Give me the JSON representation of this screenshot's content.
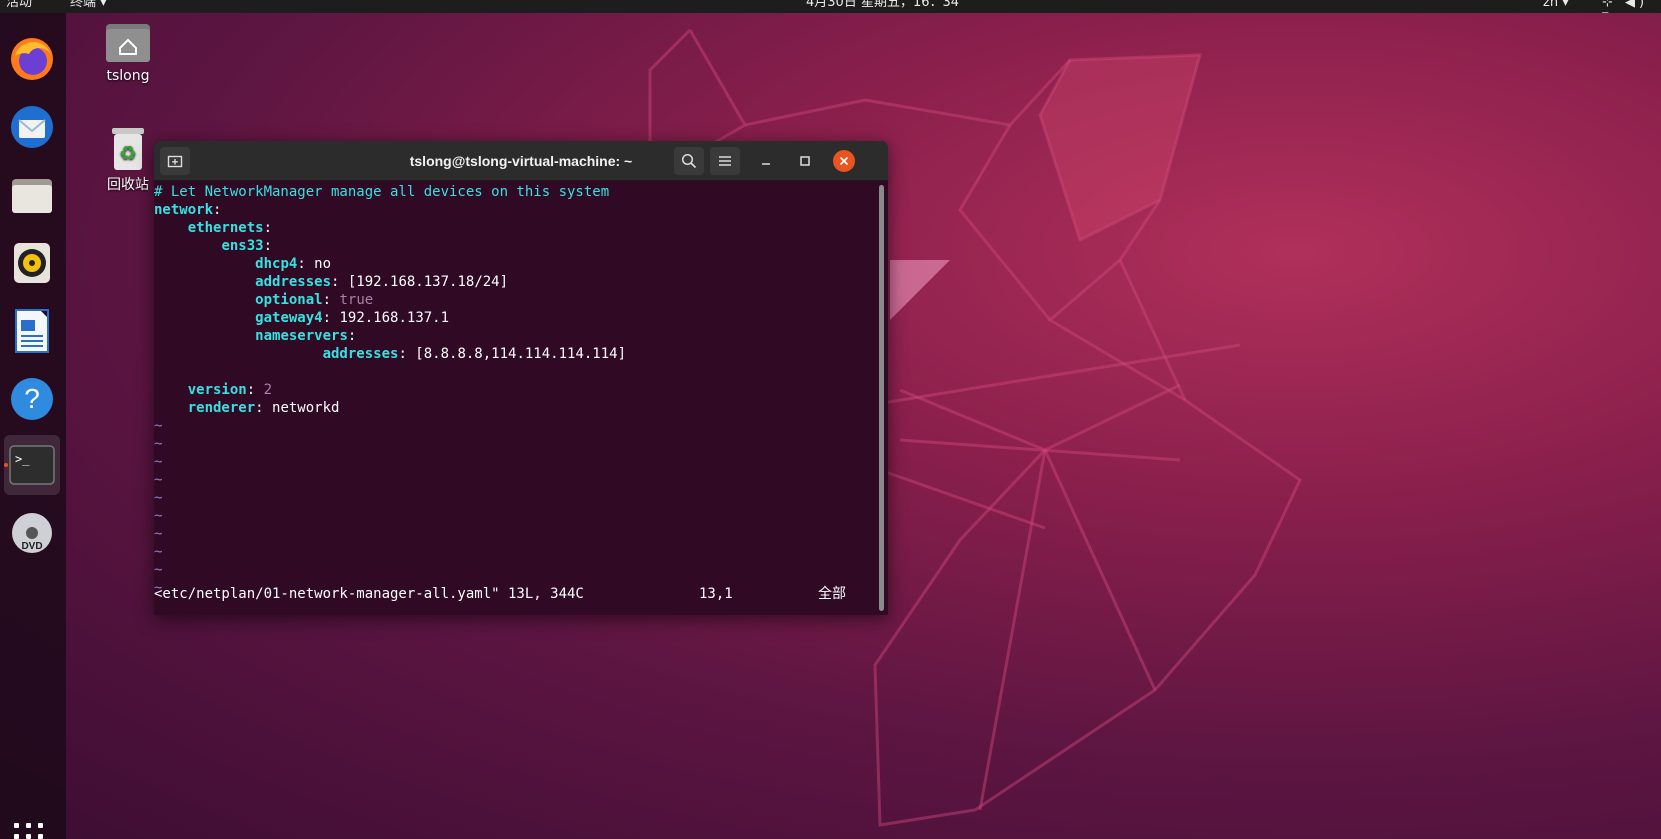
{
  "topbar": {
    "activities": "活动",
    "app_menu": "终端 ▾",
    "clock": "4月30日 星期五，16：34",
    "input_method": "zh ▾",
    "system": "⊹ ◀) ▾"
  },
  "dock": {
    "apps": [
      "firefox",
      "thunderbird",
      "files",
      "rhythmbox",
      "libreoffice-writer",
      "help",
      "terminal",
      "dvd"
    ]
  },
  "desktop": {
    "home_label": "tslong",
    "trash_label": "回收站"
  },
  "terminal": {
    "title": "tslong@tslong-virtual-machine: ~",
    "lines": [
      {
        "indent": "",
        "comment": "# Let NetworkManager manage all devices on this system"
      },
      {
        "indent": "",
        "key": "network",
        "sep": ":",
        "value": ""
      },
      {
        "indent": "    ",
        "key": "ethernets",
        "sep": ":",
        "value": ""
      },
      {
        "indent": "        ",
        "key": "ens33",
        "sep": ":",
        "value": ""
      },
      {
        "indent": "            ",
        "key": "dhcp4",
        "sep": ":",
        "value": " no"
      },
      {
        "indent": "            ",
        "key": "addresses",
        "sep": ":",
        "value": " [192.168.137.18/24]"
      },
      {
        "indent": "            ",
        "key": "optional",
        "sep": ":",
        "bool": " true"
      },
      {
        "indent": "            ",
        "key": "gateway4",
        "sep": ":",
        "value": " 192.168.137.1"
      },
      {
        "indent": "            ",
        "key": "nameservers",
        "sep": ":",
        "value": ""
      },
      {
        "indent": "                    ",
        "key": "addresses",
        "sep": ":",
        "value": " [8.8.8.8,114.114.114.114]"
      },
      {
        "indent": "",
        "blank": true
      },
      {
        "indent": "    ",
        "key": "version",
        "sep": ":",
        "bool": " 2"
      },
      {
        "indent": "    ",
        "key": "renderer",
        "sep": ":",
        "value": " networkd"
      },
      {
        "tilde": "~"
      },
      {
        "tilde": "~"
      },
      {
        "tilde": "~"
      },
      {
        "tilde": "~"
      },
      {
        "tilde": "~"
      },
      {
        "tilde": "~"
      },
      {
        "tilde": "~"
      },
      {
        "tilde": "~"
      },
      {
        "tilde": "~"
      },
      {
        "tilde": "~"
      }
    ],
    "status": {
      "file": "<etc/netplan/01-network-manager-all.yaml\" 13L, 344C",
      "position": "13,1",
      "scroll": "全部"
    }
  },
  "colors": {
    "terminal_bg": "#300a24",
    "yaml_key": "#34e2e2",
    "accent": "#e95420"
  }
}
